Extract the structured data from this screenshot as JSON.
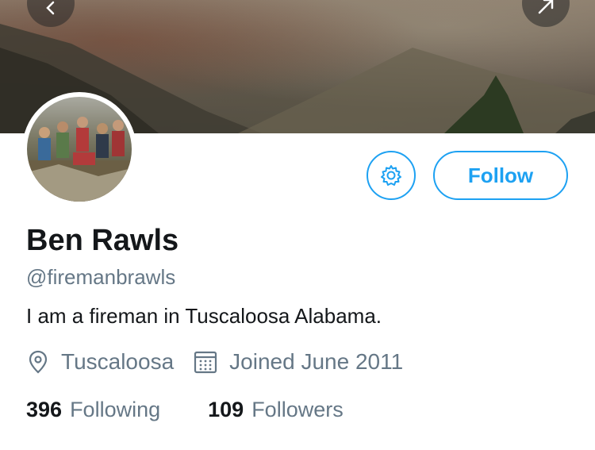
{
  "profile": {
    "name": "Ben Rawls",
    "handle": "@firemanbrawls",
    "bio": "I am a fireman in Tuscaloosa Alabama.",
    "location": "Tuscaloosa",
    "joined": "Joined June 2011"
  },
  "actions": {
    "follow_label": "Follow"
  },
  "stats": {
    "following_count": "396",
    "following_label": "Following",
    "followers_count": "109",
    "followers_label": "Followers"
  },
  "icons": {
    "back": "back-arrow-icon",
    "share": "share-icon",
    "settings": "gear-icon",
    "location": "location-pin-icon",
    "calendar": "calendar-icon"
  },
  "colors": {
    "accent": "#1da1f2",
    "text": "#14171a",
    "secondary_text": "#657786"
  }
}
